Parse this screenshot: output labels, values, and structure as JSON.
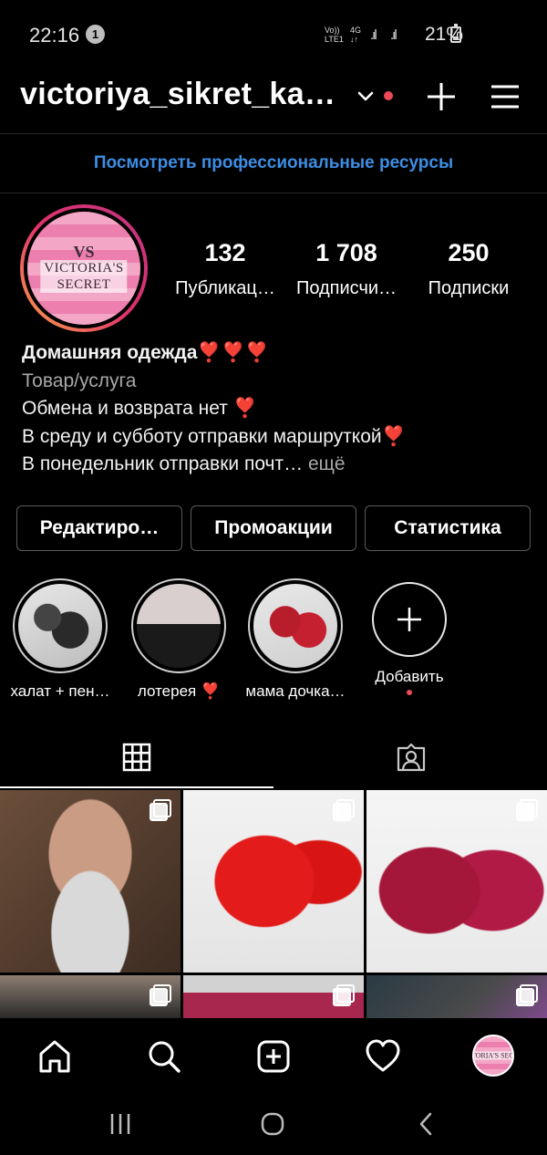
{
  "status_bar": {
    "time": "22:16",
    "notification_count": "1",
    "network_label": "Vo)) 4G LTE1",
    "battery": "21%"
  },
  "header": {
    "username": "victoriya_sikret_ka…"
  },
  "pro_link": "Посмотреть профессиональные ресурсы",
  "profile": {
    "avatar_logo_mono": "VS",
    "avatar_logo_name_1": "VICTORIA'S",
    "avatar_logo_name_2": "SECRET",
    "stats": [
      {
        "num": "132",
        "label": "Публикац…"
      },
      {
        "num": "1 708",
        "label": "Подписчи…"
      },
      {
        "num": "250",
        "label": "Подписки"
      }
    ],
    "bio": {
      "title": "Домашняя одежда",
      "category": "Товар/услуга",
      "line1": "Обмена и возврата нет",
      "line2": "В среду и субботу отправки маршруткой",
      "line3": "В понедельник отправки почт…",
      "more": "ещё"
    }
  },
  "buttons": {
    "edit": "Редактиро…",
    "promo": "Промоакции",
    "stats": "Статистика"
  },
  "highlights": [
    {
      "label": "халат + пен…"
    },
    {
      "label": "лотерея ❣️"
    },
    {
      "label": "мама дочка…"
    }
  ],
  "add_highlight_label": "Добавить",
  "nav_avatar_text": "VICTORIA'S SECRET",
  "colors": {
    "accent_link": "#3c8ee5",
    "notification_dot": "#ed4956",
    "heart": "#e21b3c"
  }
}
